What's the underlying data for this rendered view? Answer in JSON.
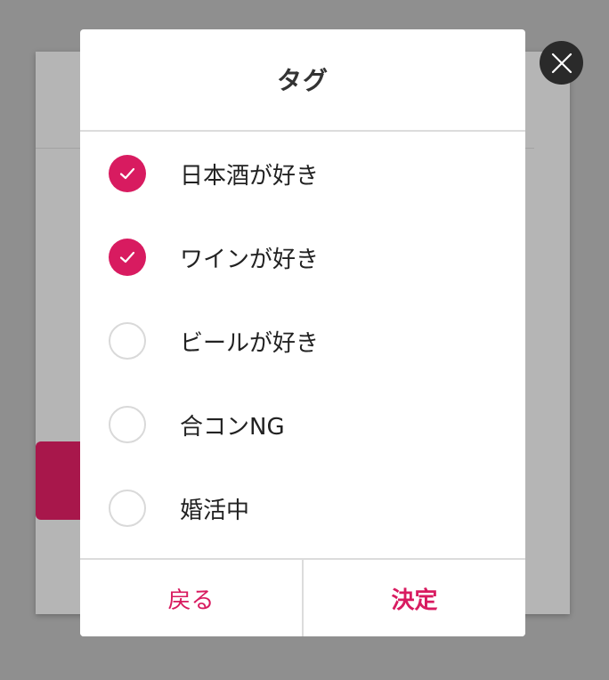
{
  "modal": {
    "title": "タグ",
    "tags": [
      {
        "label": "日本酒が好き",
        "checked": true
      },
      {
        "label": "ワインが好き",
        "checked": true
      },
      {
        "label": "ビールが好き",
        "checked": false
      },
      {
        "label": "合コンNG",
        "checked": false
      },
      {
        "label": "婚活中",
        "checked": false
      }
    ],
    "back_label": "戻る",
    "confirm_label": "決定"
  },
  "icons": {
    "close": "close-icon",
    "check": "checkmark-icon"
  },
  "colors": {
    "accent": "#d81b60",
    "overlay": "#8f8f8f",
    "close_bg": "#2a2a2a"
  }
}
